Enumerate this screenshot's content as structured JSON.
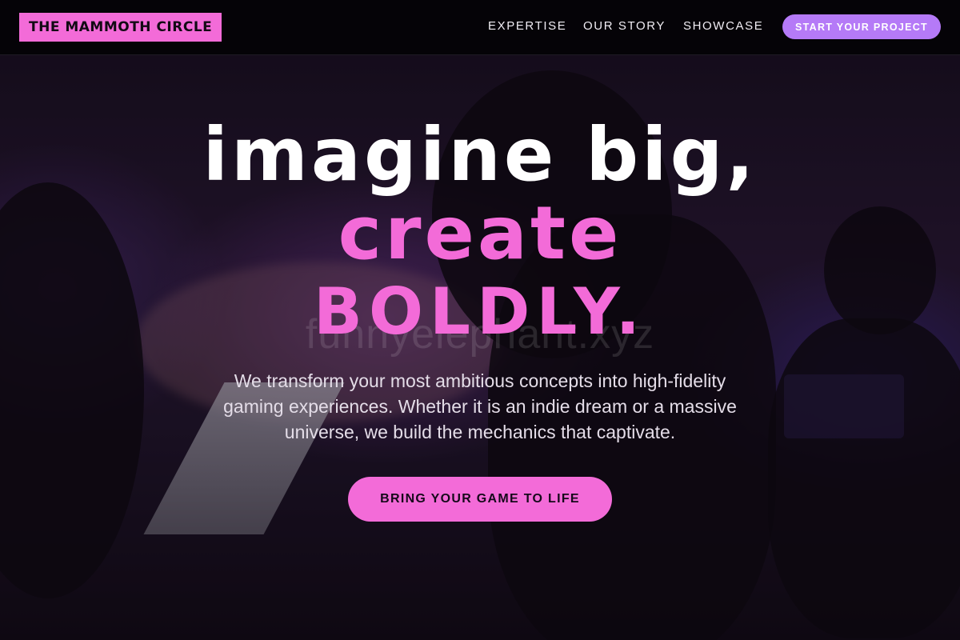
{
  "header": {
    "logo_text": "THE MAMMOTH CIRCLE",
    "nav": [
      "EXPERTISE",
      "OUR STORY",
      "SHOWCASE"
    ],
    "cta_label": "START YOUR PROJECT"
  },
  "hero": {
    "headline_line1": "IMAGINE BIG,",
    "headline_line2": "CREATE",
    "headline_line3": "BOLDLY.",
    "watermark": "funnyelephant.xyz",
    "subtitle": "We transform your most ambitious concepts into high-fidelity gaming experiences. Whether it is an indie dream or a massive universe, we build the mechanics that captivate.",
    "cta_label": "BRING YOUR GAME TO LIFE"
  },
  "colors": {
    "accent_pink": "#f36bd8",
    "accent_purple": "#b57af7",
    "header_bg": "#050307"
  }
}
